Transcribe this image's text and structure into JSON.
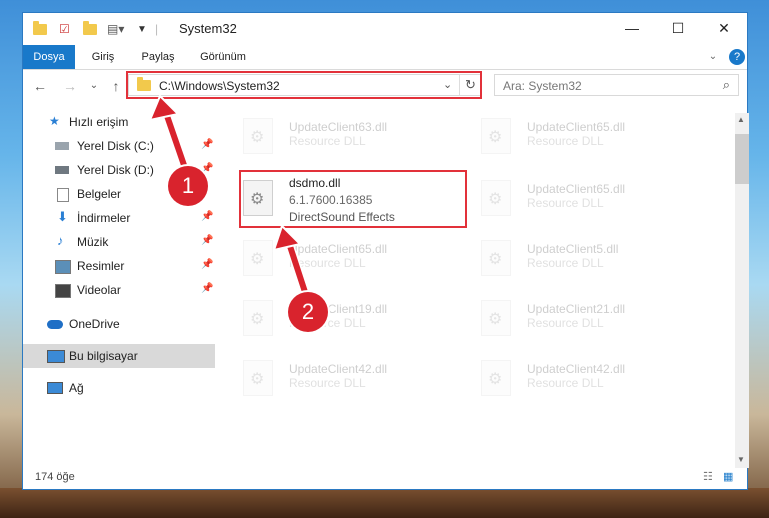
{
  "window": {
    "title": "System32"
  },
  "ribbon": {
    "tabs": [
      "Dosya",
      "Giriş",
      "Paylaş",
      "Görünüm"
    ]
  },
  "address": {
    "path": "C:\\Windows\\System32"
  },
  "search": {
    "placeholder": "Ara: System32"
  },
  "sidebar": {
    "items": [
      {
        "label": "Hızlı erişim",
        "icon": "star-icon"
      },
      {
        "label": "Yerel Disk (C:)",
        "icon": "drive-icon"
      },
      {
        "label": "Yerel Disk (D:)",
        "icon": "drive-icon"
      },
      {
        "label": "Belgeler",
        "icon": "documents-icon"
      },
      {
        "label": "İndirmeler",
        "icon": "download-icon"
      },
      {
        "label": "Müzik",
        "icon": "music-icon"
      },
      {
        "label": "Resimler",
        "icon": "pictures-icon"
      },
      {
        "label": "Videolar",
        "icon": "video-icon"
      },
      {
        "label": "OneDrive",
        "icon": "cloud-icon"
      },
      {
        "label": "Bu bilgisayar",
        "icon": "computer-icon"
      },
      {
        "label": "Ağ",
        "icon": "network-icon"
      }
    ]
  },
  "files": [
    {
      "name": "UpdateClient63.dll",
      "desc": "Resource DLL"
    },
    {
      "name": "UpdateClient65.dll",
      "desc": "Resource DLL"
    },
    {
      "name": "dsdmo.dll",
      "version": "6.1.7600.16385",
      "desc": "DirectSound Effects"
    },
    {
      "name": "UpdateClient65.dll",
      "desc": "Resource DLL"
    },
    {
      "name": "UpdateClient65.dll",
      "desc": "Resource DLL"
    },
    {
      "name": "UpdateClient5.dll",
      "desc": "Resource DLL"
    },
    {
      "name": "UpdateClient19.dll",
      "desc": "Resource DLL"
    },
    {
      "name": "UpdateClient21.dll",
      "desc": "Resource DLL"
    },
    {
      "name": "UpdateClient42.dll",
      "desc": "Resource DLL"
    },
    {
      "name": "UpdateClient42.dll",
      "desc": "Resource DLL"
    }
  ],
  "status": {
    "count": "174 öğe"
  },
  "annotations": {
    "step1": "1",
    "step2": "2"
  },
  "colors": {
    "accent": "#1979ca",
    "highlight": "#e2313a"
  }
}
